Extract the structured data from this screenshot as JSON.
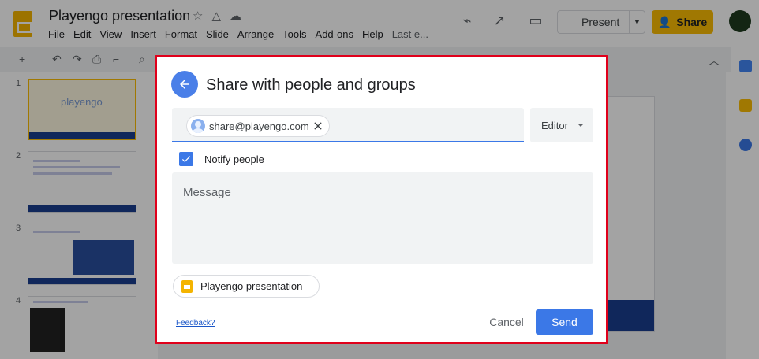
{
  "app": {
    "doc_title": "Playengo presentation",
    "menu": [
      "File",
      "Edit",
      "View",
      "Insert",
      "Format",
      "Slide",
      "Arrange",
      "Tools",
      "Add-ons",
      "Help",
      "Last e..."
    ],
    "present_label": "Present",
    "share_label": "Share",
    "slide_numbers": [
      "1",
      "2",
      "3",
      "4"
    ],
    "thumb1_brand": "playengo"
  },
  "dialog": {
    "title": "Share with people and groups",
    "recipient_email": "share@playengo.com",
    "role": "Editor",
    "notify_label": "Notify people",
    "notify_checked": true,
    "message_placeholder": "Message",
    "file_name": "Playengo presentation",
    "feedback_label": "Feedback?",
    "cancel_label": "Cancel",
    "send_label": "Send"
  },
  "colors": {
    "accent_blue": "#3b78e7",
    "highlight_border": "#e0001b",
    "slides_yellow": "#f4b400"
  }
}
